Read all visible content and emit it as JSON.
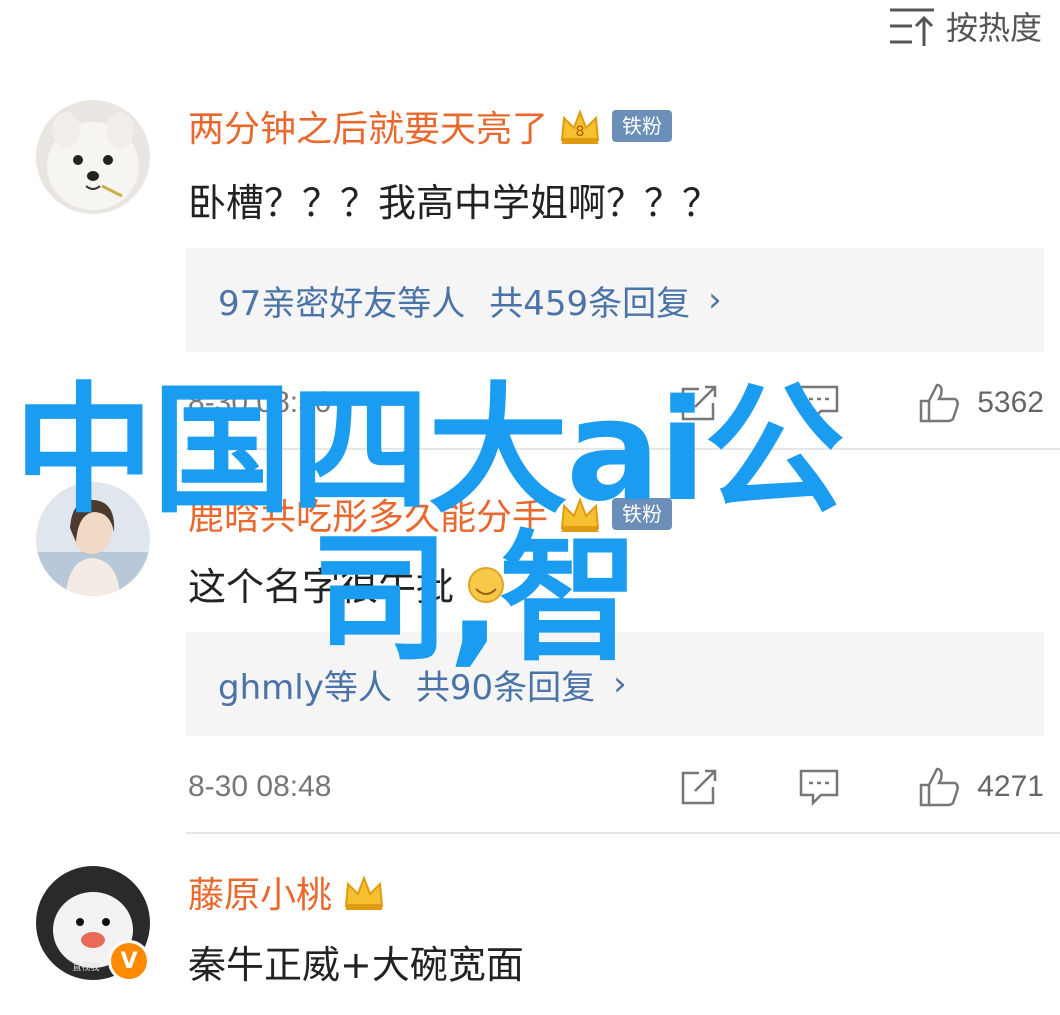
{
  "sort": {
    "label": "按热度",
    "icon": "sort-lines-icon"
  },
  "comments": [
    {
      "username": "两分钟之后就要天亮了",
      "crown_icon": "crown-icon",
      "badge": "铁粉",
      "text": "卧槽？？？我高中学姐啊？？？",
      "reply_who": "97亲密好友等人",
      "reply_count": "共459条回复",
      "timestamp": "8-30 08:50",
      "likes": "5362"
    },
    {
      "username": "鹿晗共吃彤多久能分手",
      "crown_icon": "crown-icon",
      "badge": "铁粉",
      "text": "这个名字很牛批",
      "reply_who": "ghmly等人",
      "reply_count": "共90条回复",
      "timestamp": "8-30 08:48",
      "likes": "4271"
    },
    {
      "username": "藤原小桃",
      "crown_icon": "crown-icon",
      "text": "秦牛正威+大碗宽面",
      "verified": "V"
    }
  ],
  "watermark": {
    "line1": "中国四大ai公",
    "line2": "司,智"
  },
  "colors": {
    "username": "#e8682d",
    "reply_link": "#4a73a8",
    "watermark": "#1a9cf0",
    "fan_badge": "#6b8fb8"
  }
}
